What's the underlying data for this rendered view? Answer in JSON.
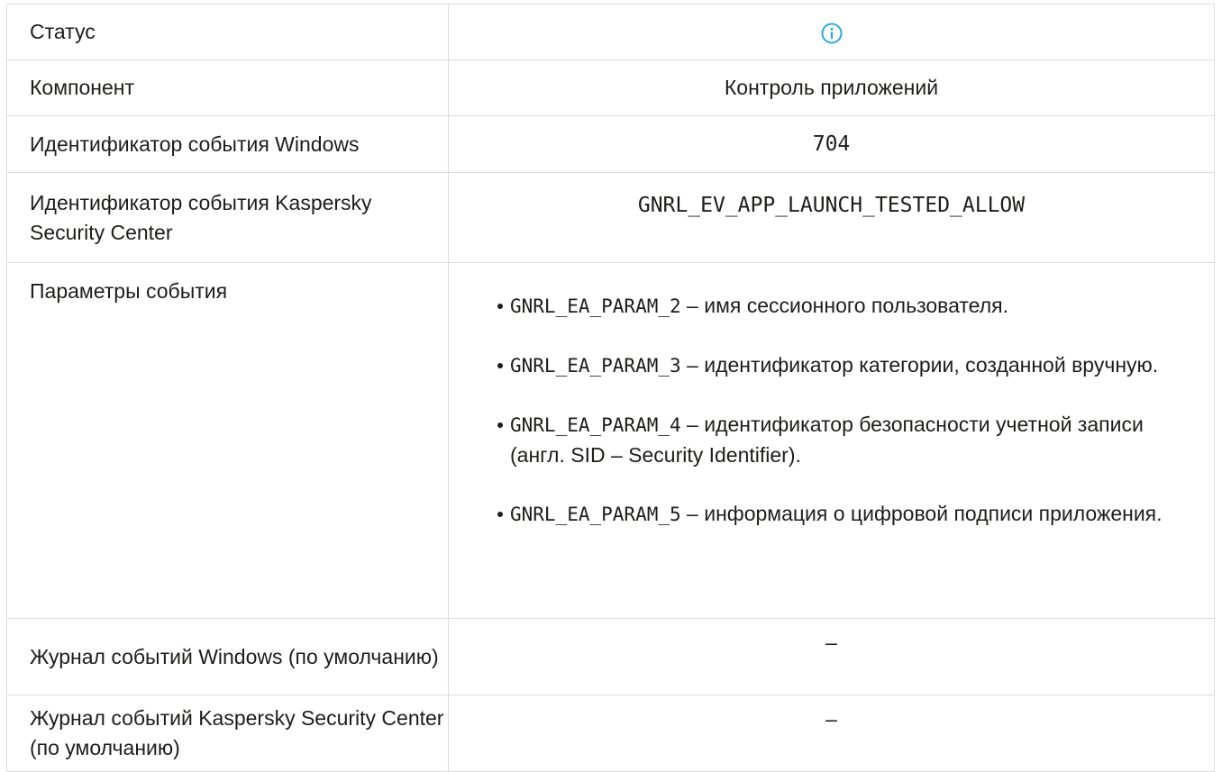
{
  "rows": {
    "status": {
      "label": "Статус",
      "icon": "info-circle-icon",
      "icon_color": "#2aa8e2"
    },
    "component": {
      "label": "Компонент",
      "value": "Контроль приложений"
    },
    "windows_event_id": {
      "label": "Идентификатор события Windows",
      "value": "704"
    },
    "ksc_event_id": {
      "label": "Идентификатор события Kaspersky Security Center",
      "value": "GNRL_EV_APP_LAUNCH_TESTED_ALLOW"
    },
    "event_params": {
      "label": "Параметры события",
      "items": [
        {
          "code": "GNRL_EA_PARAM_2",
          "text": " – имя сессионного пользователя."
        },
        {
          "code": "GNRL_EA_PARAM_3",
          "text": " – идентификатор категории, созданной вручную."
        },
        {
          "code": "GNRL_EA_PARAM_4",
          "text": " – идентификатор безопасности учетной записи (англ. SID – Security Identifier)."
        },
        {
          "code": "GNRL_EA_PARAM_5",
          "text": "  – информация о цифровой подписи приложения."
        }
      ]
    },
    "windows_log": {
      "label": "Журнал событий Windows (по умолчанию)",
      "value": "–"
    },
    "ksc_log": {
      "label": "Журнал событий Kaspersky Security Center (по умолчанию)",
      "value": "–"
    }
  }
}
